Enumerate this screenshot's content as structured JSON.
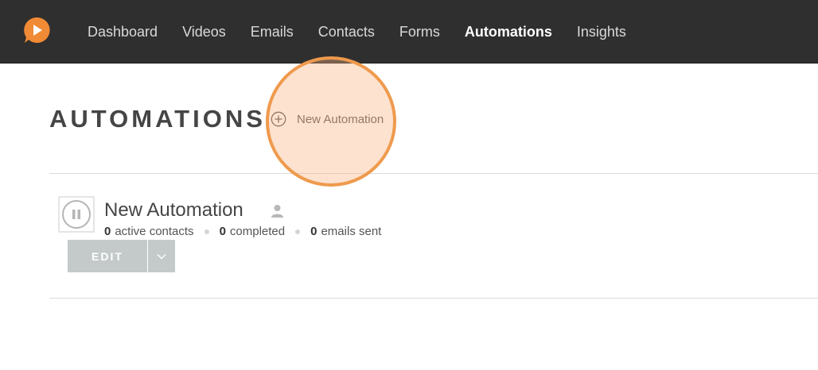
{
  "nav": {
    "items": [
      {
        "label": "Dashboard",
        "active": false
      },
      {
        "label": "Videos",
        "active": false
      },
      {
        "label": "Emails",
        "active": false
      },
      {
        "label": "Contacts",
        "active": false
      },
      {
        "label": "Forms",
        "active": false
      },
      {
        "label": "Automations",
        "active": true
      },
      {
        "label": "Insights",
        "active": false
      }
    ]
  },
  "header": {
    "title": "AUTOMATIONS",
    "new_automation_label": "New Automation"
  },
  "automation": {
    "name": "New Automation",
    "status": "paused",
    "stats": {
      "active_contacts_value": "0",
      "active_contacts_label": "active contacts",
      "completed_value": "0",
      "completed_label": "completed",
      "emails_sent_value": "0",
      "emails_sent_label": "emails sent"
    },
    "edit_label": "EDIT"
  },
  "colors": {
    "topbar": "#2f2f2f",
    "logo": "#f08a34",
    "highlight": "#ef9a4d",
    "edit_button": "#c4c9c9"
  },
  "icons": {
    "logo": "play-chat-logo-icon",
    "new_automation": "plus-circle-icon",
    "status": "pause-icon",
    "owner": "user-icon",
    "dropdown": "chevron-down-icon"
  }
}
